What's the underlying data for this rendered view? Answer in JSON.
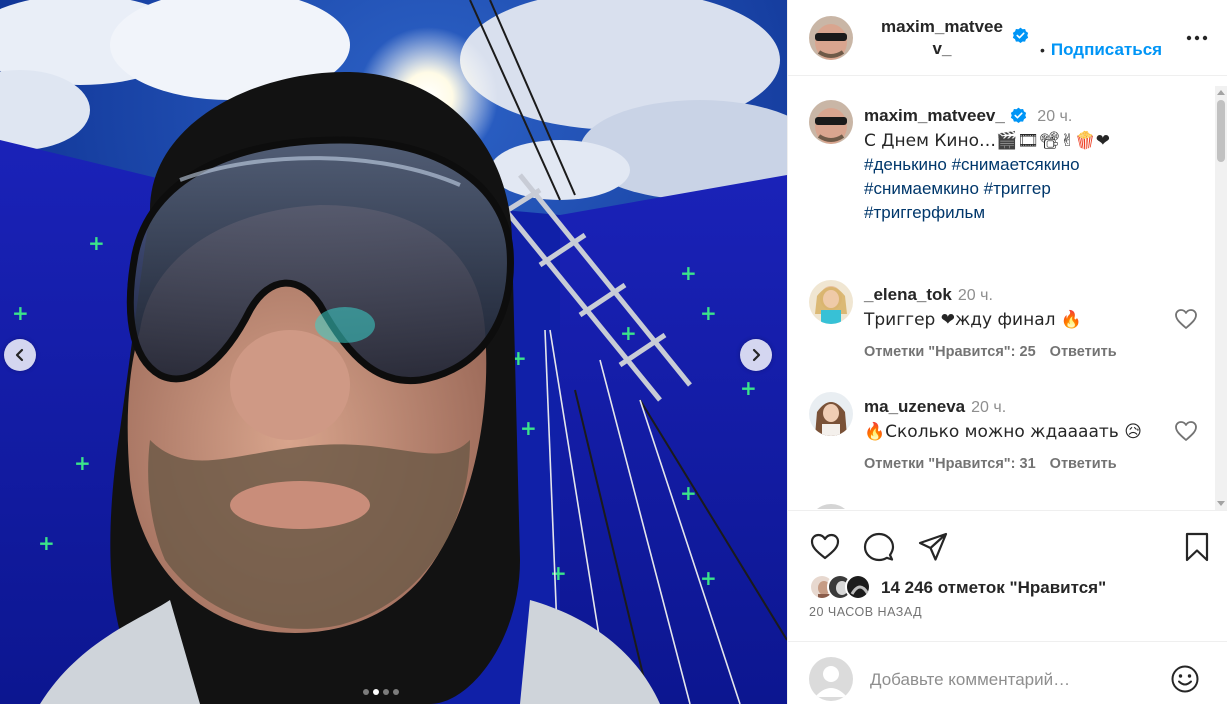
{
  "post": {
    "author": "maxim_matveev_",
    "header_author_line1": "maxim_matvee",
    "header_author_line2": "v_",
    "follow_label": "Подписаться",
    "caption_time": "20 ч.",
    "caption_text": "С Днем Кино…🎬🎞📽✌🍿❤",
    "hashtags": [
      "#денькино",
      "#снимаетсякино",
      "#снимаемкино",
      "#триггер",
      "#триггерфильм"
    ],
    "carousel": {
      "total": 4,
      "active_index": 1
    }
  },
  "comments": [
    {
      "username": "_elena_tok",
      "time": "20 ч.",
      "text": "Триггер ❤жду финал 🔥",
      "likes": "Отметки \"Нравится\": 25",
      "reply": "Ответить"
    },
    {
      "username": "ma_uzeneva",
      "time": "20 ч.",
      "text": "🔥Сколько можно ждаааать 😥",
      "likes": "Отметки \"Нравится\": 31",
      "reply": "Ответить"
    }
  ],
  "actions": {
    "likes_count": "14 246 отметок \"Нравится\"",
    "posted_ago": "20 часов назад"
  },
  "composer": {
    "placeholder": "Добавьте комментарий…"
  },
  "icons": {
    "like": "heart-icon",
    "comment": "comment-bubble-icon",
    "share": "paper-plane-icon",
    "save": "bookmark-icon",
    "more": "more-options-icon",
    "emoji": "emoji-icon",
    "verified": "verified-badge-icon",
    "prev": "chevron-left-icon",
    "next": "chevron-right-icon"
  },
  "colors": {
    "accent": "#0095f6",
    "hashtag": "#00376b",
    "muted": "#737373"
  }
}
